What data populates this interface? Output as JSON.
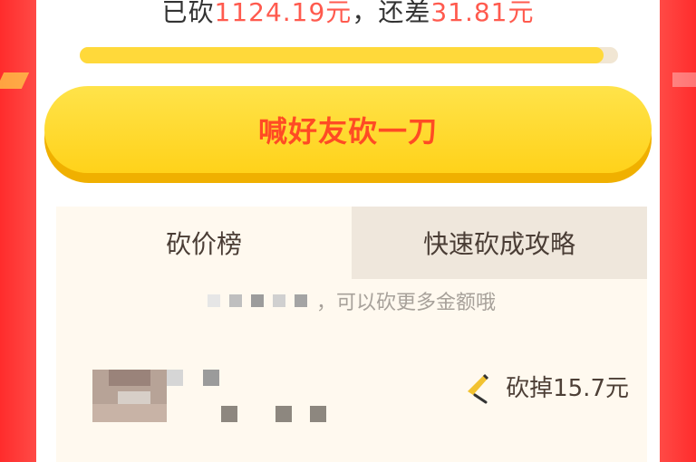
{
  "status": {
    "prefix": "已砍",
    "cut_amount": "1124.19元",
    "middle": "，还差",
    "remaining_amount": "31.81元"
  },
  "progress": {
    "fraction": 0.973
  },
  "cta": {
    "label": "喊好友砍一刀"
  },
  "tabs": [
    {
      "label": "砍价榜",
      "active": true
    },
    {
      "label": "快速砍成攻略",
      "active": false
    }
  ],
  "info": {
    "text_visible": "，可以砍更多金额哦"
  },
  "list": [
    {
      "cut_text": "砍掉15.7元",
      "icon": "knife-icon"
    }
  ],
  "colors": {
    "accent_red": "#ff4b24",
    "progress_yellow": "#ffd93a",
    "cta_yellow": "#ffd21a",
    "panel_bg": "#fff9ef",
    "tab_inactive": "#efe7dc",
    "bg_red": "#ff3a3a"
  }
}
